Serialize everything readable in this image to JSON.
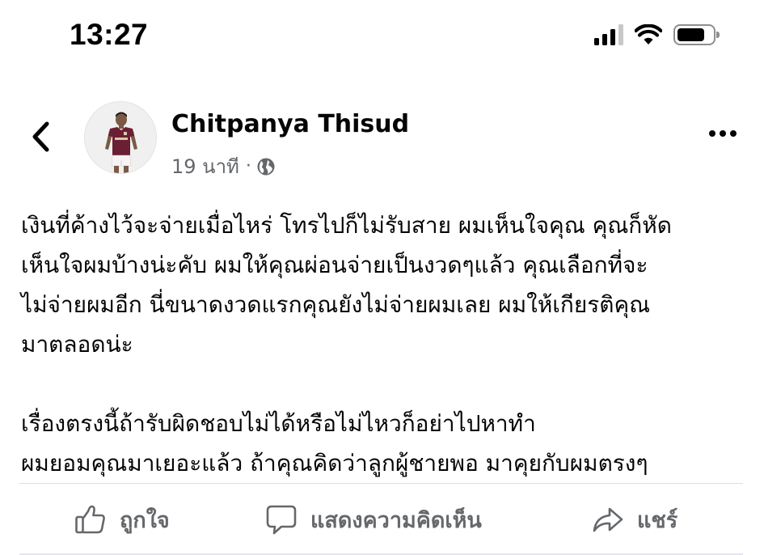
{
  "status_bar": {
    "time": "13:27"
  },
  "post": {
    "author": "Chitpanya Thisud",
    "time_ago": "19 นาที",
    "separator": "·",
    "audience_icon": "globe-icon",
    "paragraphs": [
      [
        "เงินที่ค้างไว้จะจ่ายเมื่อไหร่ โทรไปก็ไม่รับสาย ผมเห็นใจคุณ คุณก็หัด",
        "เห็นใจผมบ้างน่ะคับ ผมให้คุณผ่อนจ่ายเป็นงวดๆแล้ว คุณเลือกที่จะ",
        "ไม่จ่ายผมอีก นี่ขนาดงวดแรกคุณยังไม่จ่ายผมเลย ผมให้เกียรติคุณ",
        "มาตลอดน่ะ"
      ],
      [
        "เรื่องตรงนี้ถ้ารับผิดชอบไม่ได้หรือไม่ไหวก็อย่าไปหาทำ",
        "ผมยอมคุณมาเยอะแล้ว ถ้าคุณคิดว่าลูกผู้ชายพอ มาคุยกับผมตรงๆ"
      ]
    ]
  },
  "actions": {
    "like": "ถูกใจ",
    "comment": "แสดงความคิดเห็น",
    "share": "แชร์"
  },
  "colors": {
    "text": "#050505",
    "secondary": "#65676b",
    "divider": "#dadde1",
    "jersey": "#6b1f33"
  }
}
